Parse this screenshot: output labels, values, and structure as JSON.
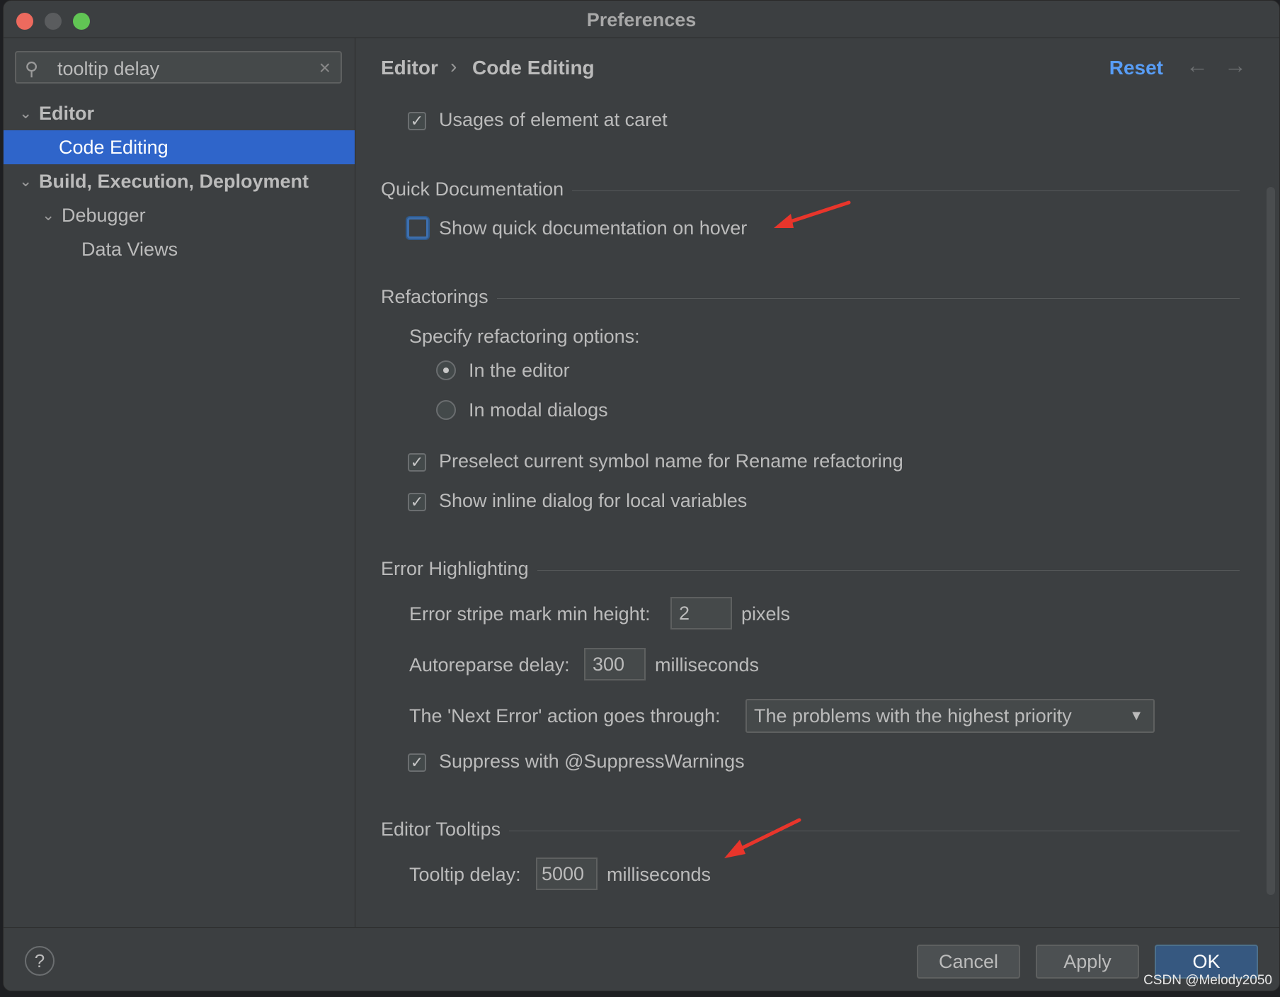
{
  "window": {
    "title": "Preferences"
  },
  "sidebar": {
    "search_value": "tooltip delay",
    "items": [
      {
        "label": "Editor"
      },
      {
        "label": "Code Editing"
      },
      {
        "label": "Build, Execution, Deployment"
      },
      {
        "label": "Debugger"
      },
      {
        "label": "Data Views"
      }
    ]
  },
  "header": {
    "crumb_1": "Editor",
    "crumb_sep": "›",
    "crumb_2": "Code Editing",
    "reset": "Reset",
    "back": "←",
    "forward": "→"
  },
  "content": {
    "usages_label": "Usages of element at caret",
    "quick_doc_title": "Quick Documentation",
    "quick_doc_hover": "Show quick documentation on hover",
    "refactorings_title": "Refactorings",
    "refactor_options": "Specify refactoring options:",
    "radio_editor": "In the editor",
    "radio_modal": "In modal dialogs",
    "preselect": "Preselect current symbol name for Rename refactoring",
    "inline_dialog": "Show inline dialog for local variables",
    "error_title": "Error Highlighting",
    "stripe_label": "Error stripe mark min height:",
    "stripe_value": "2",
    "stripe_unit": "pixels",
    "autoreparse_label": "Autoreparse delay:",
    "autoreparse_value": "300",
    "autoreparse_unit": "milliseconds",
    "next_error_label": "The 'Next Error' action goes through:",
    "next_error_value": "The problems with the highest priority",
    "suppress": "Suppress with @SuppressWarnings",
    "tooltips_title": "Editor Tooltips",
    "tooltip_label": "Tooltip delay:",
    "tooltip_value": "5000",
    "tooltip_unit": "milliseconds"
  },
  "footer": {
    "help": "?",
    "cancel": "Cancel",
    "apply": "Apply",
    "ok": "OK"
  },
  "watermark": "CSDN @Melody2050",
  "colors": {
    "accent": "#2f65ca",
    "link": "#589df6",
    "annotation": "#e8352b"
  }
}
